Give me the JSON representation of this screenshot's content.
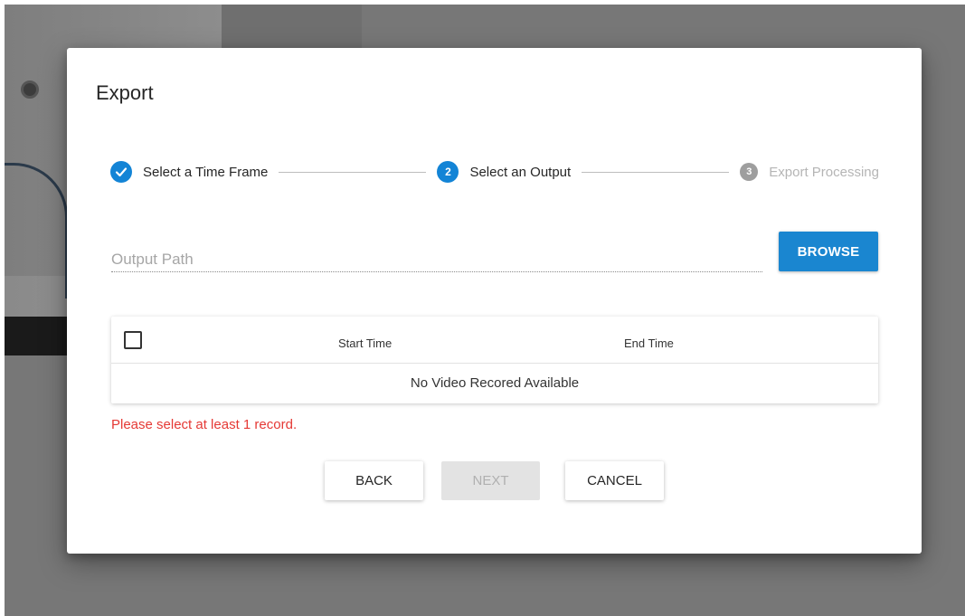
{
  "dialog": {
    "title": "Export"
  },
  "stepper": {
    "steps": [
      {
        "label": "Select a Time Frame",
        "number": "1",
        "state": "done"
      },
      {
        "label": "Select an Output",
        "number": "2",
        "state": "active"
      },
      {
        "label": "Export Processing",
        "number": "3",
        "state": "pending"
      }
    ]
  },
  "output": {
    "placeholder": "Output Path",
    "value": "",
    "browse_label": "BROWSE"
  },
  "table": {
    "columns": [
      "Start Time",
      "End Time"
    ],
    "empty_text": "No Video Recored Available"
  },
  "error": "Please select at least 1 record.",
  "buttons": {
    "back": "BACK",
    "next": "NEXT",
    "cancel": "CANCEL"
  },
  "colors": {
    "accent": "#1384d6",
    "error": "#e53935",
    "disabled_bg": "#e3e3e3"
  },
  "icons": {
    "step_done": "check-icon"
  }
}
